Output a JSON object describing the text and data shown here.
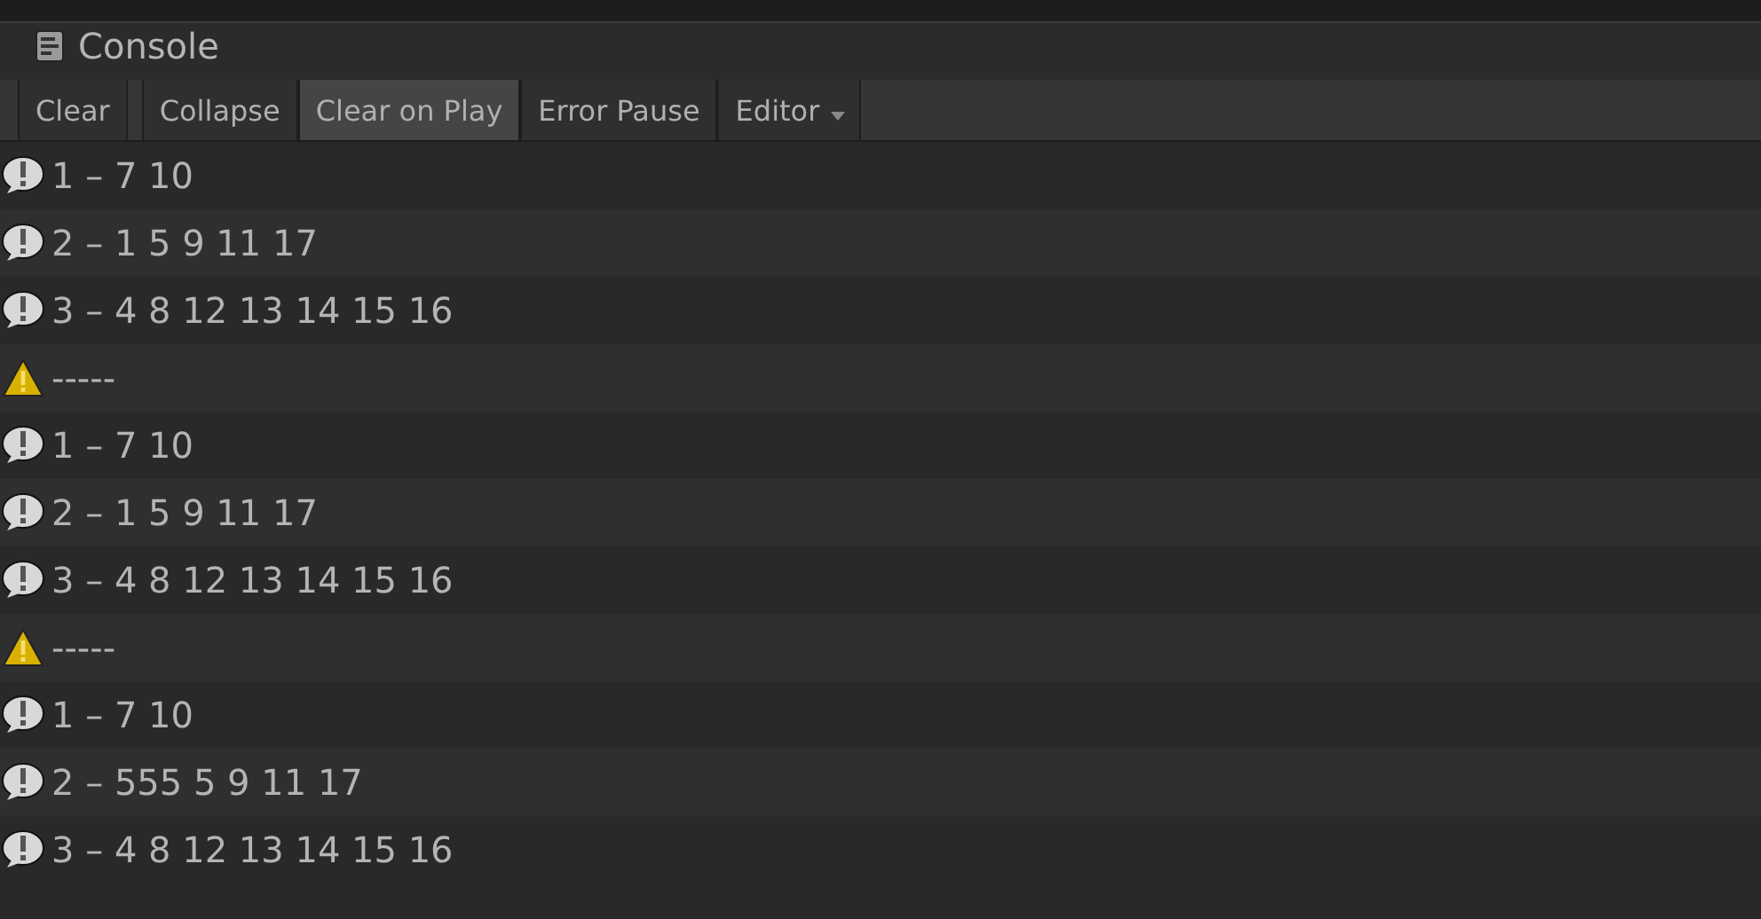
{
  "panel": {
    "title": "Console"
  },
  "toolbar": [
    {
      "label": "Clear",
      "kind": "button"
    },
    {
      "label": "Collapse",
      "kind": "toggle",
      "selected": false
    },
    {
      "label": "Clear on Play",
      "kind": "toggle",
      "selected": true
    },
    {
      "label": "Error Pause",
      "kind": "toggle",
      "selected": false
    },
    {
      "label": "Editor",
      "kind": "dropdown"
    }
  ],
  "entries": [
    {
      "kind": "log",
      "text": "1 – 7 10"
    },
    {
      "kind": "log",
      "text": "2 – 1 5 9 11 17"
    },
    {
      "kind": "log",
      "text": "3 – 4 8 12 13 14 15 16"
    },
    {
      "kind": "warning",
      "text": "-----"
    },
    {
      "kind": "log",
      "text": "1 – 7 10"
    },
    {
      "kind": "log",
      "text": "2 – 1 5 9 11 17"
    },
    {
      "kind": "log",
      "text": "3 – 4 8 12 13 14 15 16"
    },
    {
      "kind": "warning",
      "text": "-----"
    },
    {
      "kind": "log",
      "text": "1 – 7 10"
    },
    {
      "kind": "log",
      "text": "2 – 555 5 9 11 17"
    },
    {
      "kind": "log",
      "text": "3 – 4 8 12 13 14 15 16"
    }
  ]
}
